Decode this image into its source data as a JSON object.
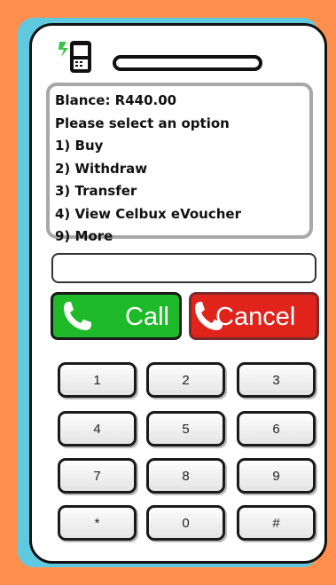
{
  "screen": {
    "lines": [
      "Blance: R440.00",
      "Please select an option",
      "1) Buy",
      "2) Withdraw",
      "3) Transfer",
      "4) View Celbux eVoucher",
      "9) More"
    ]
  },
  "input": {
    "value": ""
  },
  "buttons": {
    "call_label": "Call",
    "cancel_label": "Cancel"
  },
  "keypad": [
    "1",
    "2",
    "3",
    "4",
    "5",
    "6",
    "7",
    "8",
    "9",
    "*",
    "0",
    "#"
  ],
  "colors": {
    "frame_orange": "#ff8f4e",
    "frame_blue": "#5fcadf",
    "call_green": "#1fba2a",
    "cancel_red": "#e0241c"
  },
  "icons": [
    "mobile-phone-signal-icon",
    "phone-handset-icon"
  ]
}
